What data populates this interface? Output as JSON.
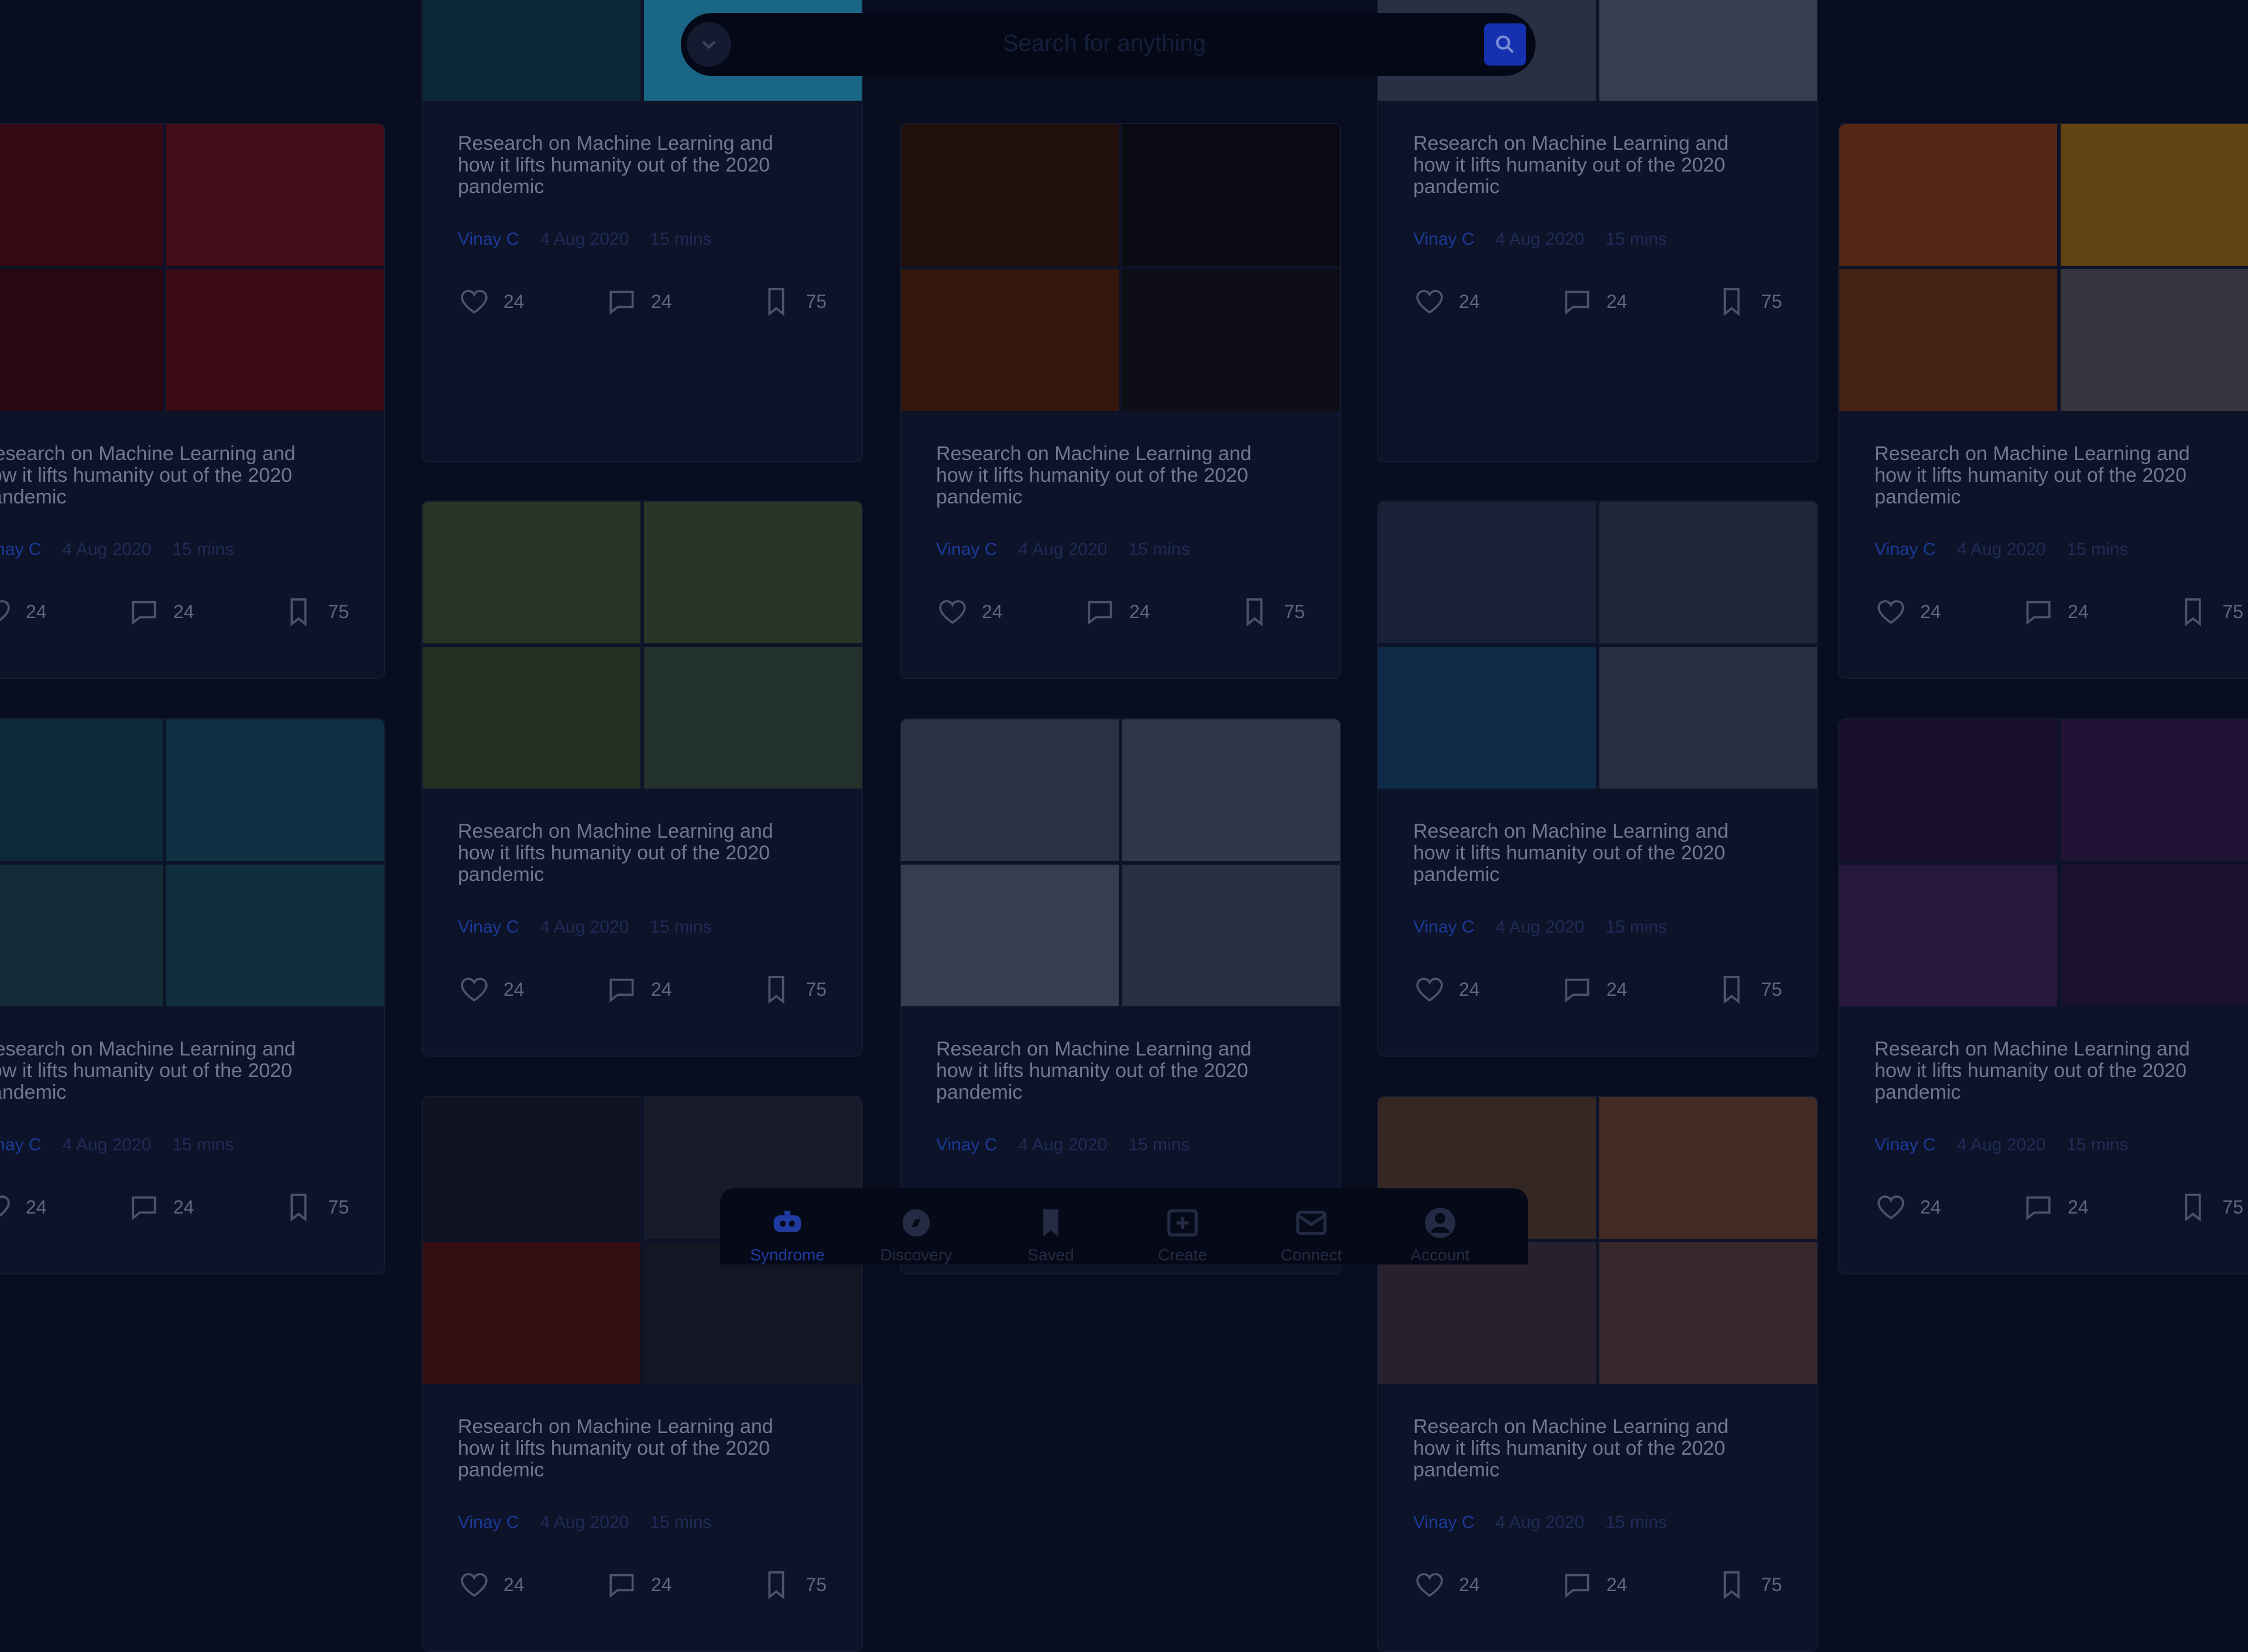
{
  "search": {
    "placeholder": "Search for anything"
  },
  "card": {
    "title": "Research on Machine Learning and how it lifts humanity out of the 2020 pandemic",
    "author": "Vinay C",
    "date": "4 Aug 2020",
    "read_time": "15 mins",
    "likes": "24",
    "comments": "24",
    "saves": "75"
  },
  "nav": [
    {
      "label": "Syndrome",
      "icon": "robot-icon",
      "active": true
    },
    {
      "label": "Discovery",
      "icon": "compass-icon"
    },
    {
      "label": "Saved",
      "icon": "bookmark-icon"
    },
    {
      "label": "Create",
      "icon": "plus-square-icon"
    },
    {
      "label": "Connect",
      "icon": "mail-icon"
    },
    {
      "label": "Account",
      "icon": "user-icon"
    }
  ],
  "colors": {
    "background": "#080d1f",
    "card": "#0d1328",
    "accent": "#1531b0",
    "author": "#1b3a9a"
  },
  "card_images": [
    "lanterns",
    "geometric-yellow",
    "fire",
    "glass-tubes",
    "book-cover",
    "green-building",
    "architecture-waves",
    "blue-wall-plants",
    "drone",
    "neuron",
    "dark-figure",
    "concert-crowd"
  ]
}
